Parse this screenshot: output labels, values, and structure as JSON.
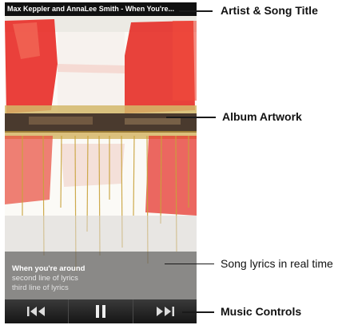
{
  "screen": {
    "song_title": "Max Keppler and AnnaLee Smith - When You're...",
    "lyrics": {
      "current": "When you're around",
      "line2": "second line of lyrics",
      "line3": "third line of lyrics"
    },
    "controls": {
      "prev_icon": "skip-previous-icon",
      "pause_icon": "pause-icon",
      "next_icon": "skip-next-icon"
    }
  },
  "callouts": {
    "artist_title": "Artist & Song Title",
    "album_artwork": "Album Artwork",
    "lyrics": "Song lyrics in real time",
    "controls": "Music Controls"
  },
  "colors": {
    "art_red": "#e8302a",
    "art_background": "#fbfaf6",
    "art_gold": "#c9a23a",
    "control_bar": "#222222"
  }
}
